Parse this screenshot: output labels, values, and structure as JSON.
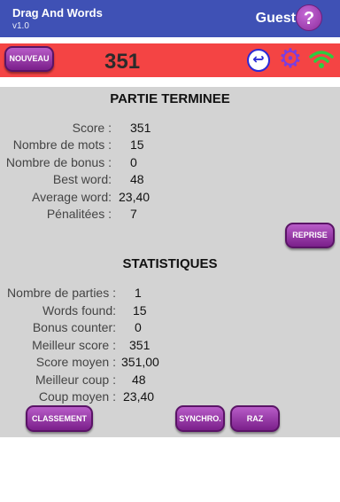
{
  "app": {
    "title": "Drag And Words",
    "version": "v1.0",
    "user": "Guest",
    "help_symbol": "?"
  },
  "toolbar": {
    "new_label": "NOUVEAU",
    "score": "351",
    "undo_symbol": "↩",
    "gear_symbol": "⚙",
    "icons": [
      "undo-icon",
      "gear-icon",
      "wifi-icon"
    ],
    "wifi_color": "#2ecc40"
  },
  "game_over": {
    "title": "PARTIE TERMINEE",
    "rows": [
      {
        "label": "Score :",
        "value": "351"
      },
      {
        "label": "Nombre de mots :",
        "value": "15"
      },
      {
        "label": "Nombre de bonus :",
        "value": "0"
      },
      {
        "label": "Best word:",
        "value": "48"
      },
      {
        "label": "Average word:",
        "value": "23,40"
      },
      {
        "label": "Pénalitées :",
        "value": "7"
      }
    ],
    "replay_label": "REPRISE"
  },
  "stats": {
    "title": "STATISTIQUES",
    "rows": [
      {
        "label": "Nombre de parties :",
        "value": "1"
      },
      {
        "label": "Words found:",
        "value": "15"
      },
      {
        "label": "Bonus counter:",
        "value": "0"
      },
      {
        "label": "Meilleur score :",
        "value": "351"
      },
      {
        "label": "Score moyen :",
        "value": "351,00"
      },
      {
        "label": "Meilleur coup :",
        "value": "48"
      },
      {
        "label": "Coup moyen :",
        "value": "23,40"
      }
    ],
    "ranking_label": "CLASSEMENT",
    "sync_label": "SYNCHRO.",
    "reset_label": "RAZ"
  },
  "colors": {
    "appbar": "#3f51b5",
    "redbar": "#f44444",
    "button": "#8e2d9e",
    "panel": "#d3d3d3"
  }
}
